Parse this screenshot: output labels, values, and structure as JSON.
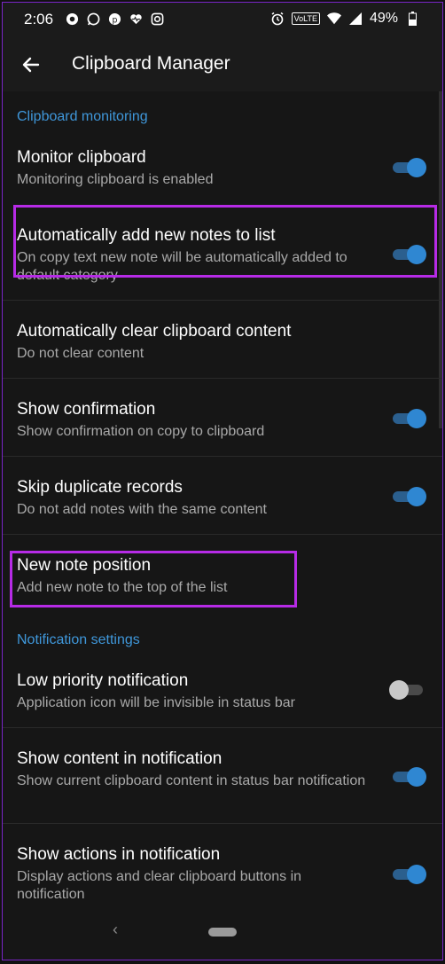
{
  "status_bar": {
    "time": "2:06",
    "network_badge": "VoLTE",
    "battery": "49%",
    "left_icons": [
      "circle-o-icon",
      "whatsapp-icon",
      "pinterest-icon",
      "heart-pulse-icon",
      "instagram-icon"
    ],
    "right_icons": [
      "alarm-icon",
      "volte-icon",
      "wifi-icon",
      "signal-icon",
      "battery-icon"
    ]
  },
  "app_bar": {
    "title": "Clipboard Manager",
    "back_icon": "arrow-left-icon"
  },
  "sections": {
    "monitoring": "Clipboard monitoring",
    "notification": "Notification settings"
  },
  "settings": [
    {
      "title": "Monitor clipboard",
      "subtitle": "Monitoring clipboard is enabled",
      "toggle": "on"
    },
    {
      "title": "Automatically add new notes to list",
      "subtitle": "On copy text new note will be automatically added to default category",
      "toggle": "on"
    },
    {
      "title": "Automatically clear clipboard content",
      "subtitle": "Do not clear content",
      "toggle": null
    },
    {
      "title": "Show confirmation",
      "subtitle": "Show confirmation on copy to clipboard",
      "toggle": "on"
    },
    {
      "title": "Skip duplicate records",
      "subtitle": "Do not add notes with the same content",
      "toggle": "on"
    },
    {
      "title": "New note position",
      "subtitle": "Add new note to the top of the list",
      "toggle": null
    },
    {
      "title": "Low priority notification",
      "subtitle": "Application icon will be invisible in status bar",
      "toggle": "off"
    },
    {
      "title": "Show content in notification",
      "subtitle": "Show current clipboard content in status bar notification",
      "toggle": "on"
    },
    {
      "title": "Show actions in notification",
      "subtitle": "Display actions and clear clipboard buttons in notification",
      "toggle": "on"
    }
  ],
  "colors": {
    "accent": "#3f97da",
    "toggle_on": "#2f87d2",
    "highlight": "#b62be6",
    "background": "#161616"
  }
}
